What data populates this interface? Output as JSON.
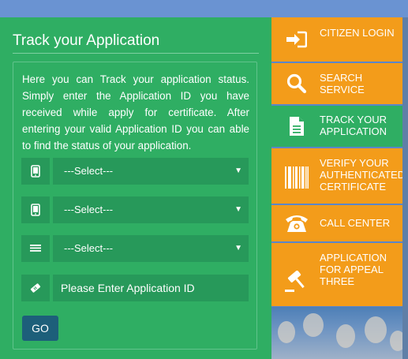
{
  "panel": {
    "title": "Track your Application",
    "description": "Here you can Track your application status. Simply enter the Application ID you have received while apply for certificate. After entering your valid Application ID you can able to find the status of your application.",
    "selects": [
      {
        "value": "---Select---"
      },
      {
        "value": "---Select---"
      },
      {
        "value": "---Select---"
      }
    ],
    "application_id_placeholder": "Please Enter Application ID",
    "go_label": "GO"
  },
  "side_menu": {
    "items": [
      {
        "label": "CITIZEN LOGIN",
        "icon": "sign-in-icon"
      },
      {
        "label": "SEARCH SERVICE",
        "icon": "search-icon"
      },
      {
        "label": "TRACK YOUR APPLICATION",
        "icon": "document-icon"
      },
      {
        "label": "VERIFY YOUR AUTHENTICATED CERTIFICATE",
        "icon": "barcode-icon"
      },
      {
        "label": "CALL CENTER",
        "icon": "phone-icon"
      },
      {
        "label": "APPLICATION FOR APPEAL THREE",
        "icon": "gavel-icon"
      }
    ],
    "active_index": 2
  },
  "colors": {
    "panel_green": "#2fae63",
    "field_green": "#27995a",
    "menu_orange": "#f39c1a",
    "go_button": "#1d5f7a"
  }
}
